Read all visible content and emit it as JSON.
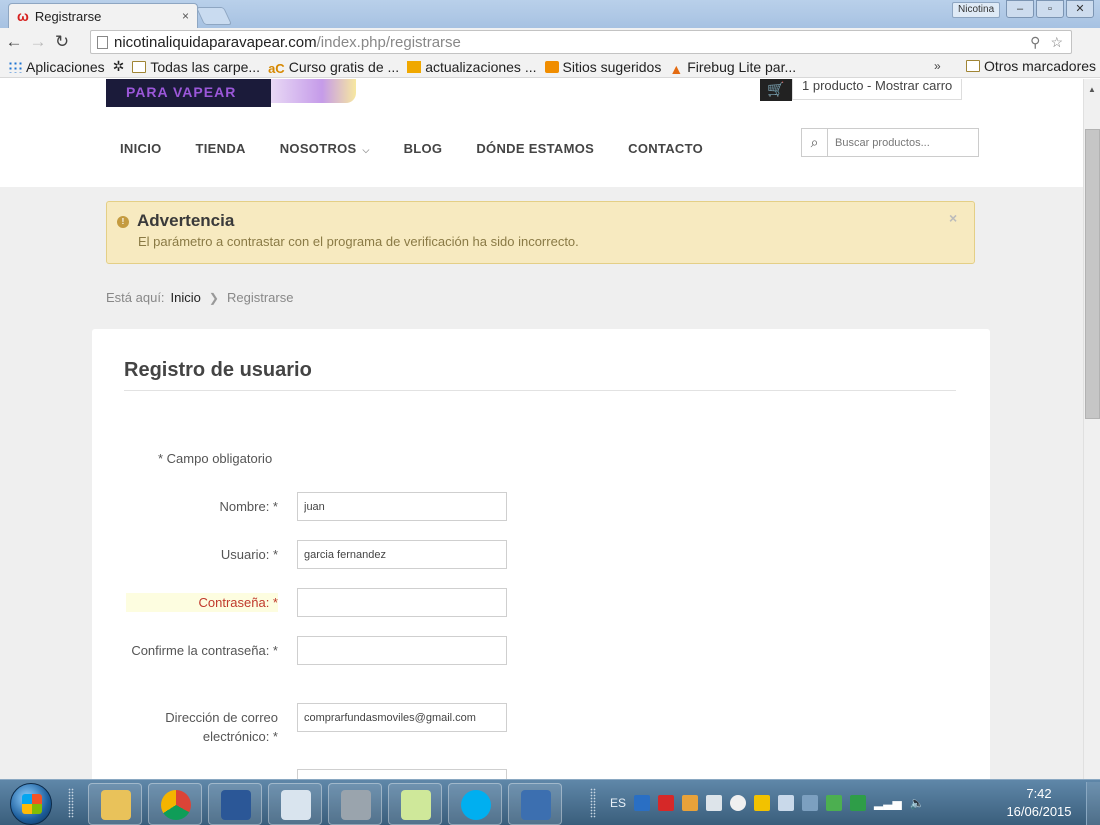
{
  "browser": {
    "tab_title": "Registrarse",
    "tab_close": "×",
    "profile_name": "Nicotina",
    "url_host": "nicotinaliquidaparavapear.com",
    "url_path": "/index.php/registrarse",
    "bookmarks": [
      {
        "icon": "apps-icon",
        "label": "Aplicaciones"
      },
      {
        "icon": "gear-icon",
        "label": ""
      },
      {
        "icon": "folder-icon",
        "label": "Todas las carpe..."
      },
      {
        "icon": "ac-icon",
        "label": "Curso gratis de ..."
      },
      {
        "icon": "bing-icon",
        "label": "actualizaciones ..."
      },
      {
        "icon": "sites-icon",
        "label": "Sitios sugeridos"
      },
      {
        "icon": "firebug-icon",
        "label": "Firebug Lite par..."
      }
    ],
    "bookmarks_more": "»",
    "other_bookmarks": "Otros marcadores"
  },
  "site": {
    "logo_text": "PARA VAPEAR",
    "cart_text": "1 producto - Mostrar carro",
    "nav": [
      {
        "label": "INICIO"
      },
      {
        "label": "TIENDA"
      },
      {
        "label": "NOSOTROS",
        "has_caret": true
      },
      {
        "label": "BLOG"
      },
      {
        "label": "DÓNDE ESTAMOS"
      },
      {
        "label": "CONTACTO"
      }
    ],
    "search_placeholder": "Buscar productos..."
  },
  "alert": {
    "title": "Advertencia",
    "message": "El parámetro a contrastar con el programa de verificación ha sido incorrecto.",
    "close": "×",
    "color": "#f7eac0"
  },
  "breadcrumb": {
    "prefix": "Está aquí:",
    "home": "Inicio",
    "current": "Registrarse"
  },
  "form": {
    "title": "Registro de usuario",
    "required_note": "* Campo obligatorio",
    "fields": [
      {
        "label": "Nombre: *",
        "value": "juan",
        "type": "text"
      },
      {
        "label": "Usuario: *",
        "value": "garcia fernandez",
        "type": "text"
      },
      {
        "label": "Contraseña: *",
        "value": "",
        "type": "password",
        "error": true
      },
      {
        "label": "Confirme la contraseña: *",
        "value": "",
        "type": "password"
      },
      {
        "label": "Dirección de correo electrónico: *",
        "value": "comprarfundasmoviles@gmail.com",
        "type": "text"
      }
    ]
  },
  "taskbar": {
    "apps": [
      "explorer-icon",
      "chrome-icon",
      "word-icon",
      "snipping-tool-icon",
      "settings-icon",
      "sticky-notes-icon",
      "skype-icon",
      "network-app-icon"
    ],
    "language": "ES",
    "time": "7:42",
    "date": "16/06/2015"
  }
}
